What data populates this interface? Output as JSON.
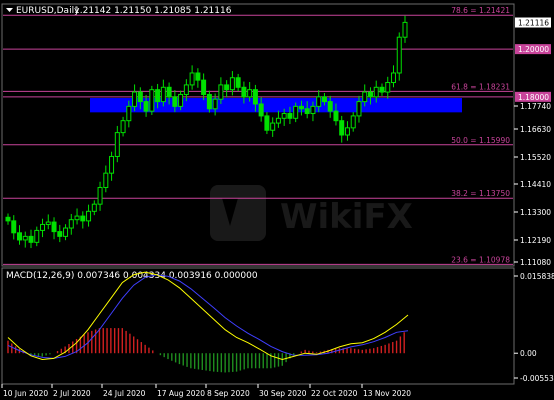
{
  "header": {
    "symbol": "EURUSD,Daily",
    "ohlc": "1.21142 1.21150 1.21085 1.21116",
    "macd_title": "MACD(12,26,9) 0.007346 0.004334 0.003916 0.000000"
  },
  "colors": {
    "background": "#000000",
    "bull": "#00e000",
    "bear": "#00e000",
    "fib": "#c8449a",
    "zone": "#0000ff",
    "macd_main": "#ffff00",
    "macd_signal": "#3f3fff",
    "hist_pos": "#d22020",
    "hist_neg": "#1f8f1f",
    "frame": "#6d6d6d"
  },
  "price_axis": {
    "ticks": [
      "1.21116",
      "1.20000",
      "1.18000",
      "1.17740",
      "1.16630",
      "1.15520",
      "1.14410",
      "1.13300",
      "1.12190",
      "1.11080"
    ],
    "badges": [
      {
        "label": "1.20000",
        "value": 1.2,
        "color": "#c8449a"
      },
      {
        "label": "1.18000",
        "value": 1.18,
        "color": "#c8449a"
      }
    ],
    "current": {
      "label": "1.21116",
      "value": 1.21116
    }
  },
  "fib_levels": [
    {
      "label": "78.6 = 1.21421",
      "value": 1.21421
    },
    {
      "label": "61.8 = 1.18231",
      "value": 1.18231
    },
    {
      "label": "50.0 = 1.15990",
      "value": 1.1599
    },
    {
      "label": "38.2 = 1.13750",
      "value": 1.1375
    },
    {
      "label": "23.6 = 1.10978",
      "value": 1.10978
    }
  ],
  "horizontal_lines": [
    {
      "label": "1.20000",
      "value": 1.2
    },
    {
      "label": "1.18000",
      "value": 1.18
    }
  ],
  "zone": {
    "top": 1.1795,
    "bottom": 1.1735
  },
  "macd_axis": {
    "ticks": [
      "0.015838",
      "0.00",
      "-0.005531"
    ]
  },
  "dates": [
    "10 Jun 2020",
    "2 Jul 2020",
    "24 Jul 2020",
    "17 Aug 2020",
    "8 Sep 2020",
    "30 Sep 2020",
    "22 Oct 2020",
    "13 Nov 2020"
  ],
  "chart_data": [
    {
      "type": "candlestick",
      "title": "EURUSD,Daily",
      "ylim": [
        1.1095,
        1.2185
      ],
      "approx_close": [
        1.128,
        1.123,
        1.12,
        1.1215,
        1.119,
        1.124,
        1.1265,
        1.1275,
        1.1235,
        1.1215,
        1.125,
        1.1285,
        1.13,
        1.128,
        1.132,
        1.135,
        1.142,
        1.148,
        1.155,
        1.165,
        1.17,
        1.176,
        1.182,
        1.178,
        1.174,
        1.183,
        1.178,
        1.184,
        1.18,
        1.176,
        1.181,
        1.185,
        1.19,
        1.187,
        1.181,
        1.175,
        1.179,
        1.185,
        1.183,
        1.188,
        1.184,
        1.18,
        1.183,
        1.177,
        1.172,
        1.166,
        1.169,
        1.171,
        1.173,
        1.171,
        1.176,
        1.175,
        1.173,
        1.176,
        1.18,
        1.178,
        1.174,
        1.17,
        1.164,
        1.167,
        1.172,
        1.178,
        1.182,
        1.18,
        1.184,
        1.182,
        1.186,
        1.19,
        1.205,
        1.2112
      ]
    },
    {
      "type": "line",
      "title": "MACD(12,26,9)",
      "ylim": [
        -0.0055,
        0.0159
      ],
      "series": [
        {
          "name": "MACD",
          "values": [
            0.003,
            0.001,
            -0.0005,
            -0.0012,
            -0.001,
            0.0002,
            0.002,
            0.0045,
            0.0075,
            0.0105,
            0.0135,
            0.015,
            0.0155,
            0.015,
            0.014,
            0.0125,
            0.0105,
            0.0085,
            0.0065,
            0.0045,
            0.003,
            0.002,
            0.0008,
            -0.0005,
            -0.0012,
            -0.0006,
            0.0,
            -0.0002,
            0.0004,
            0.0012,
            0.0018,
            0.002,
            0.0028,
            0.004,
            0.0055,
            0.0073
          ]
        },
        {
          "name": "Signal",
          "values": [
            0.0015,
            0.0005,
            -0.0003,
            -0.0008,
            -0.001,
            -0.0006,
            0.0003,
            0.002,
            0.0045,
            0.0075,
            0.0105,
            0.013,
            0.0145,
            0.015,
            0.0147,
            0.0138,
            0.0123,
            0.0105,
            0.0087,
            0.0068,
            0.0052,
            0.0038,
            0.0026,
            0.0013,
            0.0003,
            -0.0004,
            -0.0004,
            -0.0003,
            0.0,
            0.0006,
            0.0012,
            0.0016,
            0.0022,
            0.003,
            0.004,
            0.0043
          ]
        }
      ]
    }
  ]
}
